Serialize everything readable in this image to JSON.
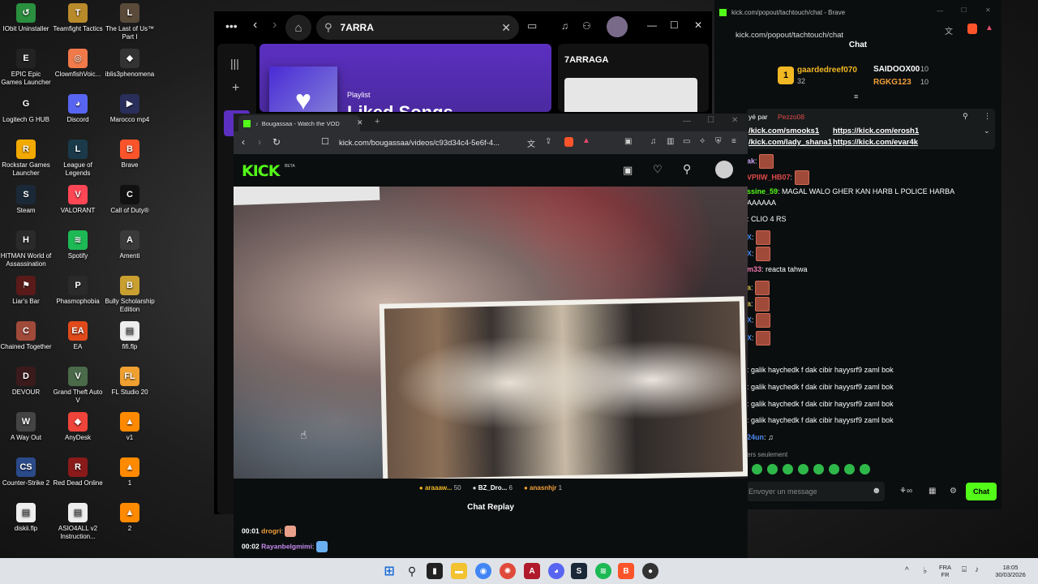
{
  "desktop": {
    "icons": [
      {
        "label": "IObit Uninstaller",
        "color": "#2a8f3f",
        "glyph": "↺"
      },
      {
        "label": "Teamfight Tactics",
        "color": "#b88a2a",
        "glyph": "T"
      },
      {
        "label": "The Last of Us™ Part I",
        "color": "#5a4a3a",
        "glyph": "L"
      },
      {
        "label": "EPIC Epic Games Launcher",
        "color": "#222222",
        "glyph": "E"
      },
      {
        "label": "ClownfishVoic...",
        "color": "#f07a4a",
        "glyph": "◎"
      },
      {
        "label": "iblis3phenomena",
        "color": "#333333",
        "glyph": "◆"
      },
      {
        "label": "Logitech G HUB",
        "color": "#1a1a1a",
        "glyph": "G"
      },
      {
        "label": "Discord",
        "color": "#5865f2",
        "glyph": "◕"
      },
      {
        "label": "Marocco mp4",
        "color": "#2a2e5a",
        "glyph": "▶"
      },
      {
        "label": "Rockstar Games Launcher",
        "color": "#f2a900",
        "glyph": "R"
      },
      {
        "label": "League of Legends",
        "color": "#1a3a4a",
        "glyph": "L"
      },
      {
        "label": "Brave",
        "color": "#fb542b",
        "glyph": "B"
      },
      {
        "label": "Steam",
        "color": "#1b2838",
        "glyph": "S"
      },
      {
        "label": "VALORANT",
        "color": "#ff4655",
        "glyph": "V"
      },
      {
        "label": "Call of Duty®",
        "color": "#111111",
        "glyph": "C"
      },
      {
        "label": "HITMAN World of Assassination",
        "color": "#2a2a2a",
        "glyph": "H"
      },
      {
        "label": "Spotify",
        "color": "#1db954",
        "glyph": "≋"
      },
      {
        "label": "Amenti",
        "color": "#3a3a3a",
        "glyph": "A"
      },
      {
        "label": "Liar's Bar",
        "color": "#5a1a1a",
        "glyph": "⚑"
      },
      {
        "label": "Phasmophobia",
        "color": "#2a2a2a",
        "glyph": "P"
      },
      {
        "label": "Bully Scholarship Edition",
        "color": "#c9a030",
        "glyph": "B"
      },
      {
        "label": "Chained Together",
        "color": "#a04a3a",
        "glyph": "C"
      },
      {
        "label": "EA",
        "color": "#e04a1a",
        "glyph": "EA"
      },
      {
        "label": "fifi.flp",
        "color": "#eeeeee",
        "glyph": "▤"
      },
      {
        "label": "DEVOUR",
        "color": "#3a1a1a",
        "glyph": "D"
      },
      {
        "label": "Grand Theft Auto V",
        "color": "#4a6a4a",
        "glyph": "V"
      },
      {
        "label": "FL Studio 20",
        "color": "#f0a030",
        "glyph": "FL"
      },
      {
        "label": "A Way Out",
        "color": "#444444",
        "glyph": "W"
      },
      {
        "label": "AnyDesk",
        "color": "#ef443b",
        "glyph": "◆"
      },
      {
        "label": "v1",
        "color": "#ff8a00",
        "glyph": "▲"
      },
      {
        "label": "Counter-Strike 2",
        "color": "#2a4a8a",
        "glyph": "CS"
      },
      {
        "label": "Red Dead Online",
        "color": "#8a1a1a",
        "glyph": "R"
      },
      {
        "label": "1",
        "color": "#ff8a00",
        "glyph": "▲"
      },
      {
        "label": "diskii.flp",
        "color": "#eeeeee",
        "glyph": "▤"
      },
      {
        "label": "ASIO4ALL v2 Instruction...",
        "color": "#eeeeee",
        "glyph": "▤"
      },
      {
        "label": "2",
        "color": "#ff8a00",
        "glyph": "▲"
      }
    ]
  },
  "spotify": {
    "search_value": "7ARRA",
    "playlist_kicker": "Playlist",
    "playlist_title": "Liked Songs",
    "right_card_title": "7ARRAGA"
  },
  "chat_window": {
    "tab_title": "kick.com/popout/tachtouch/chat - Brave",
    "url": "kick.com/popout/tachtouch/chat",
    "header": "Chat",
    "top_gifters": {
      "rank": "1",
      "first_name": "gaardedreef070",
      "first_count": "32",
      "second_name": "SAIDOOX00",
      "second_count": "10",
      "third_name": "RGKG123",
      "third_count": "10"
    },
    "pinned_by": "yé par",
    "pinned_user": "Pezzo08",
    "pinned_links_1a": "/kick.com/smooks1",
    "pinned_links_1b": "https://kick.com/erosh1",
    "pinned_links_2a": "/kick.com/lady_shana1",
    "pinned_links_2b": "https://kick.com/evar4k",
    "messages": [
      {
        "user": "ak",
        "text": ":"
      },
      {
        "user": "VPIIW_HB07",
        "text": ":"
      },
      {
        "user": "ssine_59",
        "text": ": MAGAL WALO GHER KAN HARB L POLICE HARBA"
      },
      {
        "user": "",
        "text": "AAAAAA"
      },
      {
        "user": "",
        "text": ": CLIO 4 RS"
      },
      {
        "user": "X",
        "text": ":"
      },
      {
        "user": "X",
        "text": ":"
      },
      {
        "user": "m33",
        "text": ": reacta tahwa"
      },
      {
        "user": "a",
        "text": ":"
      },
      {
        "user": "a",
        "text": ":"
      },
      {
        "user": "X",
        "text": ":"
      },
      {
        "user": "X",
        "text": ":"
      },
      {
        "user": "",
        "text": ": galik haychedk f dak cibir hayysrf9 zaml bok"
      },
      {
        "user": "",
        "text": ": galik haychedk f dak cibir hayysrf9 zaml bok"
      },
      {
        "user": "",
        "text": ": galik haychedk f dak cibir hayysrf9 zaml bok"
      },
      {
        "user": "",
        "text": ": galik haychedk f dak cibir hayysrf9 zaml bok"
      },
      {
        "user": "24un",
        "text": ": ♫"
      }
    ],
    "followers_only": "ers seulement",
    "input_placeholder": "Envoyer un message",
    "send_label": "Chat"
  },
  "vod_window": {
    "tab_title": "Bougassaa - Watch the VOD",
    "url": "kick.com/bougassaa/videos/c93d34c4-5e6f-4...",
    "logo": "KICK",
    "logo_beta": "BETA",
    "stats": [
      {
        "user": "araaaw...",
        "count": "50"
      },
      {
        "user": "BZ_Dro...",
        "count": "6"
      },
      {
        "user": "anasnhjr",
        "count": "1"
      }
    ],
    "replay_title": "Chat Replay",
    "replay": [
      {
        "time": "00:01",
        "user": "drogri",
        "user_color": "#f2a03a"
      },
      {
        "time": "00:02",
        "user": "Rayanbelgmimi",
        "user_color": "#c78bf0"
      }
    ]
  },
  "taskbar": {
    "lang_top": "FRA",
    "lang_bottom": "FR",
    "time": "18:05",
    "date": "30/03/2026"
  }
}
